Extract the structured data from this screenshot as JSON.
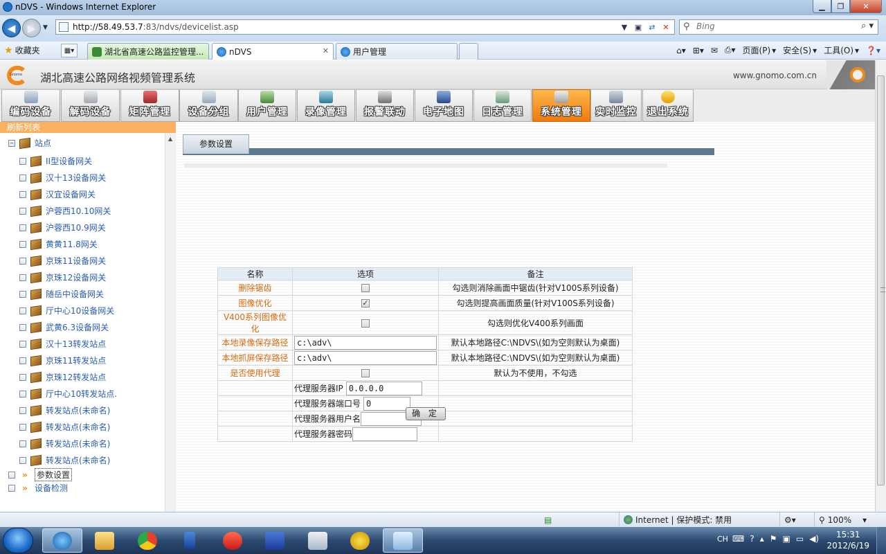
{
  "browser": {
    "window_title": "nDVS - Windows Internet Explorer",
    "url_host": "http://58.49.53.7",
    "url_path": ":83/ndvs/devicelist.asp",
    "search_placeholder": "Bing",
    "favorites_label": "收藏夹",
    "tabs": [
      {
        "label": "湖北省高速公路监控管理..."
      },
      {
        "label": "nDVS"
      },
      {
        "label": "用户管理"
      }
    ],
    "commands": {
      "page": "页面(P)",
      "safety": "安全(S)",
      "tools": "工具(O)"
    },
    "status": {
      "zone": "Internet | 保护模式: 禁用",
      "zoom": "100%"
    }
  },
  "app": {
    "title": "湖北高速公路网络视频管理系统",
    "site": "www.gnomo.com.cn",
    "logo_text": "Gnomo"
  },
  "menu": [
    {
      "label": "编码设备",
      "icon": "encoder-icon"
    },
    {
      "label": "解码设备",
      "icon": "decoder-icon"
    },
    {
      "label": "矩阵管理",
      "icon": "matrix-icon"
    },
    {
      "label": "设备分组",
      "icon": "device-group-icon"
    },
    {
      "label": "用户管理",
      "icon": "users-icon"
    },
    {
      "label": "录像管理",
      "icon": "film-icon"
    },
    {
      "label": "报警联动",
      "icon": "alarm-icon"
    },
    {
      "label": "电子地图",
      "icon": "map-icon"
    },
    {
      "label": "日志管理",
      "icon": "log-icon"
    },
    {
      "label": "系统管理",
      "icon": "tools-icon",
      "active": true
    },
    {
      "label": "实时监控",
      "icon": "monitor-icon"
    },
    {
      "label": "退出系统",
      "icon": "exit-icon"
    }
  ],
  "sidebar": {
    "refresh_label": "刷新列表",
    "root": "站点",
    "items": [
      "II型设备网关",
      "汉十13设备网关",
      "汉宜设备网关",
      "沪蓉西10.10网关",
      "沪蓉西10.9网关",
      "黄黄11.8网关",
      "京珠11设备网关",
      "京珠12设备网关",
      "随岳中设备网关",
      "厅中心10设备网关",
      "武黄6.3设备网关",
      "汉十13转发站点",
      "京珠11转发站点",
      "京珠12转发站点",
      "厅中心10转发站点.",
      "转发站点(未命名)",
      "转发站点(未命名)",
      "转发站点(未命名)",
      "转发站点(未命名)"
    ],
    "params_label": "参数设置",
    "detect_label": "设备检测"
  },
  "panel": {
    "tab_label": "参数设置",
    "headers": {
      "name": "名称",
      "option": "选项",
      "note": "备注"
    },
    "rows": [
      {
        "name": "删除锯齿",
        "checked": false,
        "note": "勾选则消除画面中锯齿(针对V100S系列设备)"
      },
      {
        "name": "图像优化",
        "checked": true,
        "note": "勾选则提高画面质量(针对V100S系列设备)"
      },
      {
        "name": "V400系列图像优化",
        "checked": false,
        "note": "勾选则优化V400系列画面"
      },
      {
        "name": "本地录像保存路径",
        "value": "c:\\adv\\",
        "note": "默认本地路径C:\\NDVS\\(如为空则默认为桌面)"
      },
      {
        "name": "本地抓屏保存路径",
        "value": "c:\\adv\\",
        "note": "默认本地路径C:\\NDVS\\(如为空则默认为桌面)"
      },
      {
        "name": "是否使用代理",
        "checked": false,
        "note": "默认为不使用，不勾选"
      }
    ],
    "proxy": {
      "ip_label": "代理服务器IP",
      "ip_value": "0.0.0.0",
      "port_label": "代理服务器端口号",
      "port_value": "0",
      "user_label": "代理服务器用户名",
      "user_value": "",
      "pass_label": "代理服务器密码",
      "pass_value": ""
    },
    "ok_label": "确 定"
  },
  "taskbar": {
    "lang": "CH",
    "time": "15:31",
    "date": "2012/6/19"
  }
}
